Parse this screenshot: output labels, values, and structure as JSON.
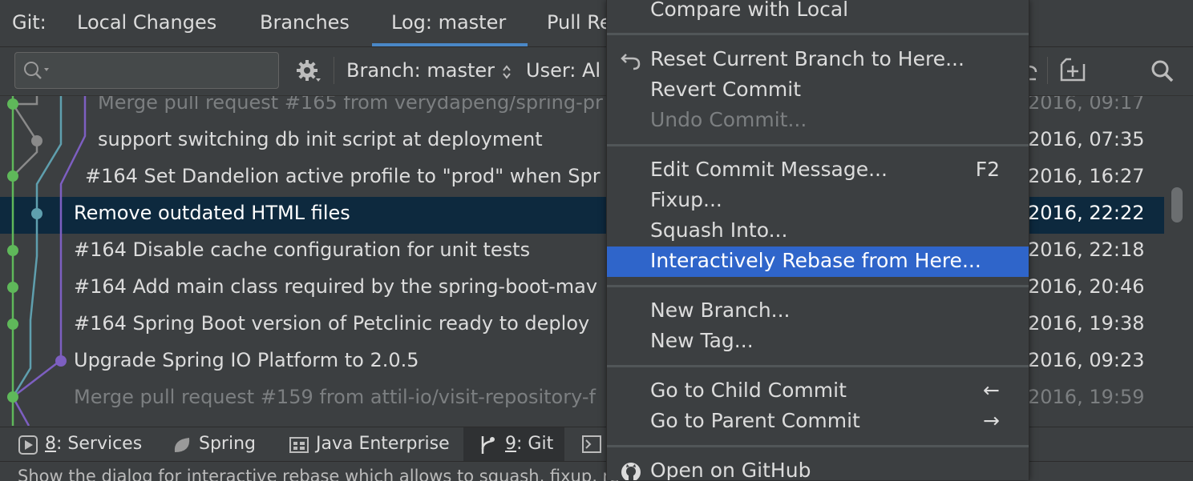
{
  "tabs": {
    "git_prefix": "Git:",
    "local_changes": "Local Changes",
    "branches": "Branches",
    "log": "Log: master",
    "pull_requests": "Pull Re"
  },
  "toolbar": {
    "search_placeholder": "",
    "branch_filter": "Branch: master",
    "user_filter": "User: Al"
  },
  "commits": [
    {
      "message": "Merge pull request #165 from verydapeng/spring-pr",
      "date": "2016, 09:17",
      "dim": true
    },
    {
      "message": "support switching db init script at deployment",
      "date": "2016, 07:35",
      "dim": false
    },
    {
      "message": "#164 Set Dandelion active profile to \"prod\" when Spr",
      "date": "2016, 16:27",
      "dim": false
    },
    {
      "message": "Remove outdated HTML files",
      "date": "2016, 22:22",
      "dim": false,
      "selected": true
    },
    {
      "message": "#164 Disable cache configuration for unit tests",
      "date": "2016, 22:18",
      "dim": false
    },
    {
      "message": "#164 Add main class required by the spring-boot-mav",
      "date": "2016, 20:46",
      "dim": false
    },
    {
      "message": "#164 Spring Boot version of Petclinic ready to deploy",
      "date": "2016, 19:38",
      "dim": false
    },
    {
      "message": "Upgrade Spring IO Platform to 2.0.5",
      "date": "2016, 09:23",
      "dim": false
    },
    {
      "message": "Merge pull request #159 from attil-io/visit-repository-f",
      "date": "2016, 19:59",
      "dim": true
    }
  ],
  "graph_colors": {
    "green": "#5fb85a",
    "gray": "#8a8a8a",
    "teal": "#5f9fae",
    "purple": "#7d5fc1"
  },
  "context_menu": {
    "compare_with_local": "Compare with Local",
    "reset_branch": "Reset Current Branch to Here...",
    "revert_commit": "Revert Commit",
    "undo_commit": "Undo Commit...",
    "edit_message": "Edit Commit Message...",
    "edit_message_shortcut": "F2",
    "fixup": "Fixup...",
    "squash_into": "Squash Into...",
    "interactive_rebase": "Interactively Rebase from Here...",
    "new_branch": "New Branch...",
    "new_tag": "New Tag...",
    "go_to_child": "Go to Child Commit",
    "go_to_child_shortcut": "←",
    "go_to_parent": "Go to Parent Commit",
    "go_to_parent_shortcut": "→",
    "open_github": "Open on GitHub",
    "highlight_color": "#2f65ca"
  },
  "bottom_tools": {
    "services_num": "8",
    "services": ": Services",
    "spring": "Spring",
    "java_enterprise": "Java Enterprise",
    "git_num": "9",
    "git": ": Git"
  },
  "status": "Show the dialog for interactive rebase which allows to squash, fixup, re"
}
